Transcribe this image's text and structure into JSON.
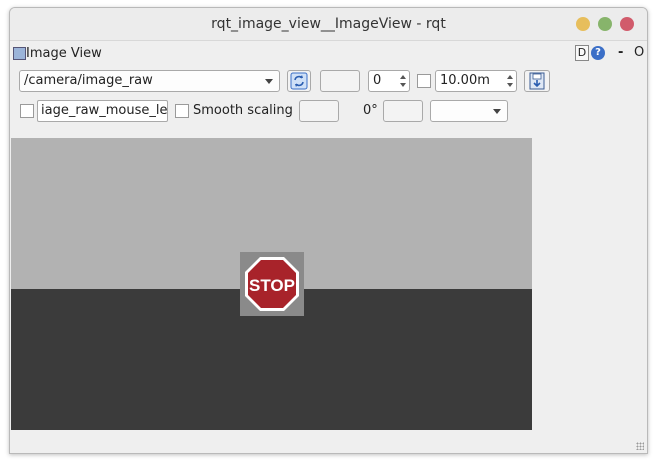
{
  "window": {
    "title": "rqt_image_view__ImageView - rqt",
    "buttons": {
      "minimize": "#e7be5c",
      "maximize": "#87b46b",
      "close": "#d15b6b"
    }
  },
  "pane": {
    "label": "Image View",
    "d_label": "D",
    "help_label": "?",
    "dash_label": "-",
    "o_label": "O"
  },
  "toolbar1": {
    "topic": "/camera/image_raw",
    "refresh_icon": "refresh-icon",
    "num_value": "0",
    "rate_value": "10.00m",
    "save_icon": "save-icon"
  },
  "toolbar2": {
    "mouse_topic": "iage_raw_mouse_left",
    "smooth_label": "Smooth scaling",
    "rotation_label": "0°"
  },
  "image": {
    "stop_text": "STOP",
    "colors": {
      "wall": "#b2b2b2",
      "floor": "#3b3b3b",
      "sign": "#a8232a"
    }
  }
}
